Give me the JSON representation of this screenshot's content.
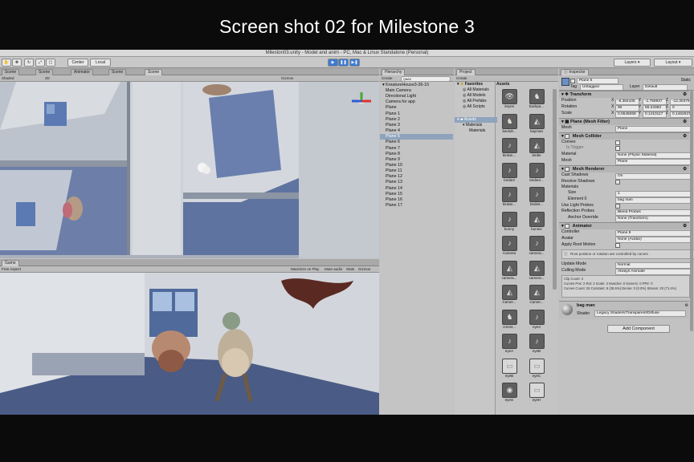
{
  "caption": "Screen shot 02 for Milestone 3",
  "window_title": "Mileston03.unity - Model and anim - PC, Mac & Linux Standalone (Personal)",
  "toolbar": {
    "center": "Center",
    "local": "Local",
    "layers": "Layers",
    "layout": "Layout"
  },
  "scene_tabs": [
    "Scene",
    "Scene",
    "Animator",
    "Scene",
    "Scene"
  ],
  "scene_subbar": {
    "shading": "Shaded",
    "mode2d": "2D",
    "gizmos": "Gizmos"
  },
  "game": {
    "tab": "Game",
    "aspect": "Free Aspect",
    "max_on_play": "Maximize on Play",
    "mute": "Mute audio",
    "stats": "Stats",
    "gizmos": "Gizmos"
  },
  "hierarchy": {
    "tab": "Hierarchy",
    "create": "Create",
    "search_placeholder": "Q▾All",
    "root": "KreatureHouse3-26-15",
    "items": [
      "Main Camera",
      "Directional Light",
      "Camera for app",
      "Plane",
      "Plane 1",
      "Plane 2",
      "Plane 3",
      "Plane 4",
      "Plane 5",
      "Plane 6",
      "Plane 7",
      "Plane 8",
      "Plane 9",
      "Plane 10",
      "Plane 11",
      "Plane 12",
      "Plane 13",
      "Plane 14",
      "Plane 15",
      "Plane 16",
      "Plane 17"
    ],
    "selected": "Plane 5"
  },
  "project": {
    "tab": "Project",
    "create": "Create",
    "favorites": "Favorites",
    "fav_items": [
      "All Materials",
      "All Models",
      "All Prefabs",
      "All Scripts"
    ],
    "assets_folder": "Assets",
    "sub_folders": [
      "Materials",
      "Materials"
    ],
    "assets_header": "Assets",
    "asset_items": [
      {
        "label": "2eyes",
        "icon": "eyes-icon"
      },
      {
        "label": "backpa...",
        "icon": "figure-icon"
      },
      {
        "label": "backdr...",
        "icon": "figure-icon"
      },
      {
        "label": "bayman",
        "icon": "unity-icon"
      },
      {
        "label": "birdan...",
        "icon": "audio-icon"
      },
      {
        "label": "birdie",
        "icon": "unity-icon"
      },
      {
        "label": "birdie3",
        "icon": "audio-icon"
      },
      {
        "label": "birdie3...",
        "icon": "audio-icon"
      },
      {
        "label": "birdan...",
        "icon": "audio-icon"
      },
      {
        "label": "birdiet...",
        "icon": "audio-icon"
      },
      {
        "label": "bunny",
        "icon": "audio-icon"
      },
      {
        "label": "bunnie",
        "icon": "unity-icon"
      },
      {
        "label": "Camera",
        "icon": "audio-icon"
      },
      {
        "label": "camera...",
        "icon": "audio-icon"
      },
      {
        "label": "camera...",
        "icon": "unity-icon"
      },
      {
        "label": "camera...",
        "icon": "unity-icon"
      },
      {
        "label": "Camer...",
        "icon": "unity-icon"
      },
      {
        "label": "Camer...",
        "icon": "unity-icon"
      },
      {
        "label": "cresst...",
        "icon": "figure-icon"
      },
      {
        "label": "eye4",
        "icon": "audio-icon"
      },
      {
        "label": "eyeA",
        "icon": "audio-icon"
      },
      {
        "label": "eyeB",
        "icon": "audio-icon"
      },
      {
        "label": "eyeB",
        "icon": "blank-icon"
      },
      {
        "label": "eyeC",
        "icon": "blank-icon"
      },
      {
        "label": "eyeG",
        "icon": "eye-icon"
      },
      {
        "label": "eyeH",
        "icon": "blank-icon"
      }
    ]
  },
  "inspector": {
    "tab": "Inspector",
    "object_name": "Plane 5",
    "static": "Static",
    "tag_label": "Tag",
    "tag": "Untagged",
    "layer_label": "Layer",
    "layer": "Default",
    "transform": {
      "title": "Transform",
      "position_label": "Position",
      "rotation_label": "Rotation",
      "scale_label": "Scale",
      "position": [
        "-6.384105",
        "-1.759937",
        "-12.30379"
      ],
      "rotation": [
        "90",
        "65.23392",
        "0"
      ],
      "scale": [
        "0.0645069",
        "0.1410117",
        "0.1462537"
      ]
    },
    "mesh_filter": {
      "title": "Plane (Mesh Filter)",
      "mesh_label": "Mesh",
      "mesh": "Plane"
    },
    "mesh_collider": {
      "title": "Mesh Collider",
      "convex": "Convex",
      "is_trigger": "Is Trigger",
      "material_label": "Material",
      "material": "None (Physic Material)",
      "mesh_label": "Mesh",
      "mesh": "Plane"
    },
    "mesh_renderer": {
      "title": "Mesh Renderer",
      "cast_shadows_label": "Cast Shadows",
      "cast_shadows": "On",
      "receive_shadows": "Receive Shadows",
      "materials": "Materials",
      "size_label": "Size",
      "size": "1",
      "element0_label": "Element 0",
      "element0": "bag man",
      "use_light_probes": "Use Light Probes",
      "reflection_probes_label": "Reflection Probes",
      "reflection_probes": "Blend Probes",
      "anchor_override_label": "Anchor Override",
      "anchor_override": "None (Transform)"
    },
    "animator": {
      "title": "Animator",
      "controller_label": "Controller",
      "controller": "Plane 9",
      "avatar_label": "Avatar",
      "avatar": "None (Avatar)",
      "apply_root_motion": "Apply Root Motion",
      "info": "Root position or rotation are controlled by curves",
      "update_mode_label": "Update Mode",
      "update_mode": "Normal",
      "culling_mode_label": "Culling Mode",
      "culling_mode": "Always Animate",
      "clip_info": "Clip Count: 2\nCurves Pos: 2 Rot: 2 Scale: 2 Muscles: 0 Generic: 0 PPtr: 0\nCurves Count: 28 Constant: 8 (28.6%) Dense: 0 (0.0%) Stream: 20 (71.4%)"
    },
    "material": {
      "name": "bag man",
      "shader_label": "Shader",
      "shader": "Legacy Shaders/Transparent/Diffuse"
    },
    "add_component": "Add Component"
  }
}
